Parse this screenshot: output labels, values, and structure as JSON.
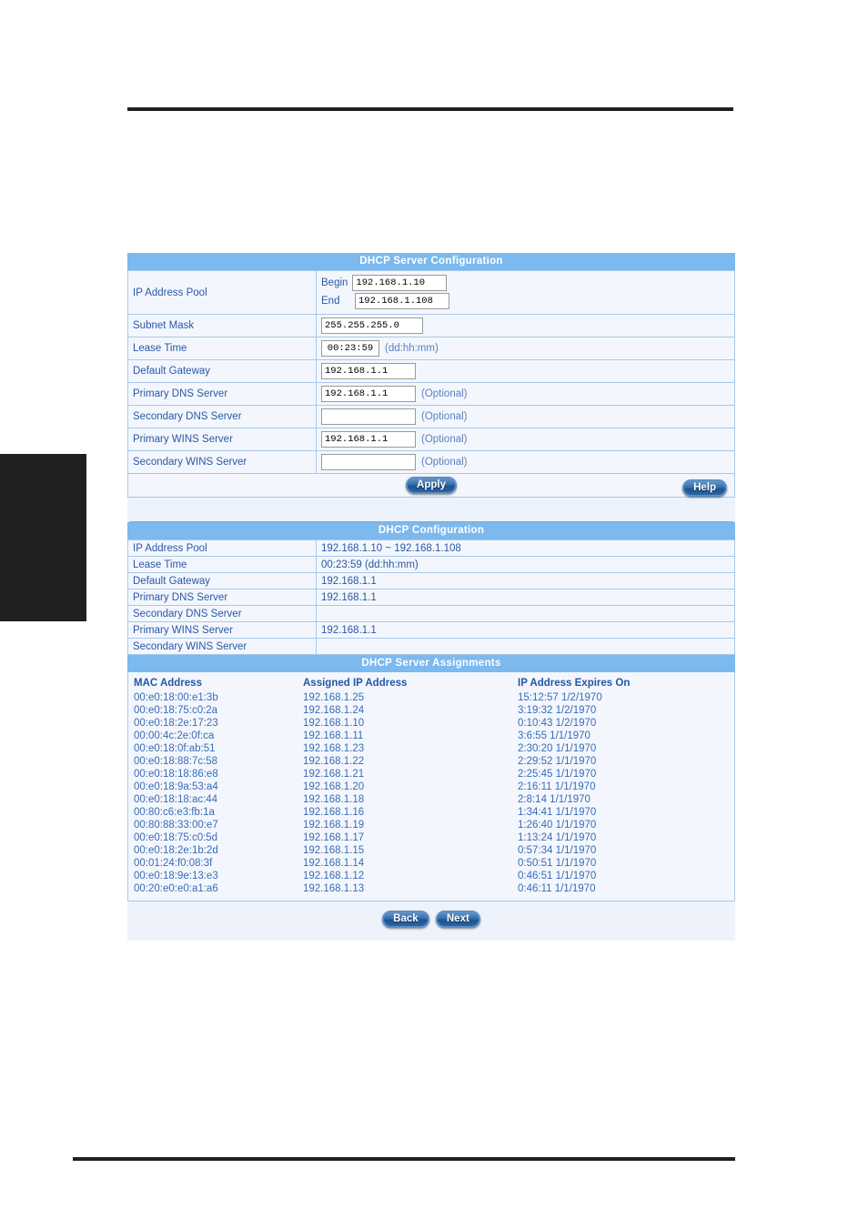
{
  "colors": {
    "bar": "#7bb9ef",
    "panel_bg": "#eef3fb",
    "cell_bg": "#f3f7fd",
    "border": "#a8c8ea",
    "text_blue": "#2b57a6",
    "rule": "#211f1f"
  },
  "config_form": {
    "title": "DHCP Server Configuration",
    "rows": {
      "ip_pool_label": "IP Address Pool",
      "begin_label": "Begin",
      "begin_value": "192.168.1.10",
      "end_label": "End",
      "end_value": "192.168.1.108",
      "subnet_mask_label": "Subnet Mask",
      "subnet_mask_value": "255.255.255.0",
      "lease_time_label": "Lease Time",
      "lease_time_value": "00:23:59",
      "lease_time_format": "(dd:hh:mm)",
      "default_gateway_label": "Default Gateway",
      "default_gateway_value": "192.168.1.1",
      "primary_dns_label": "Primary DNS Server",
      "primary_dns_value": "192.168.1.1",
      "primary_dns_optional": "(Optional)",
      "secondary_dns_label": "Secondary DNS Server",
      "secondary_dns_value": "",
      "secondary_dns_optional": "(Optional)",
      "primary_wins_label": "Primary WINS Server",
      "primary_wins_value": "192.168.1.1",
      "primary_wins_optional": "(Optional)",
      "secondary_wins_label": "Secondary WINS Server",
      "secondary_wins_value": "",
      "secondary_wins_optional": "(Optional)"
    },
    "apply_label": "Apply",
    "help_label": "Help"
  },
  "config_summary": {
    "title": "DHCP Configuration",
    "rows": [
      {
        "key": "IP Address Pool",
        "value": "192.168.1.10 ~ 192.168.1.108"
      },
      {
        "key": "Lease Time",
        "value": "00:23:59 (dd:hh:mm)"
      },
      {
        "key": "Default Gateway",
        "value": "192.168.1.1"
      },
      {
        "key": "Primary DNS Server",
        "value": "192.168.1.1"
      },
      {
        "key": "Secondary DNS Server",
        "value": ""
      },
      {
        "key": "Primary WINS Server",
        "value": "192.168.1.1"
      },
      {
        "key": "Secondary WINS Server",
        "value": ""
      }
    ]
  },
  "assignments": {
    "title": "DHCP Server Assignments",
    "headers": [
      "MAC Address",
      "Assigned IP Address",
      "IP Address Expires On"
    ],
    "rows": [
      {
        "mac": "00:e0:18:00:e1:3b",
        "ip": "192.168.1.25",
        "expires": "15:12:57 1/2/1970"
      },
      {
        "mac": "00:e0:18:75:c0:2a",
        "ip": "192.168.1.24",
        "expires": "3:19:32 1/2/1970"
      },
      {
        "mac": "00:e0:18:2e:17:23",
        "ip": "192.168.1.10",
        "expires": "0:10:43 1/2/1970"
      },
      {
        "mac": "00:00:4c:2e:0f:ca",
        "ip": "192.168.1.11",
        "expires": "3:6:55 1/1/1970"
      },
      {
        "mac": "00:e0:18:0f:ab:51",
        "ip": "192.168.1.23",
        "expires": "2:30:20 1/1/1970"
      },
      {
        "mac": "00:e0:18:88:7c:58",
        "ip": "192.168.1.22",
        "expires": "2:29:52 1/1/1970"
      },
      {
        "mac": "00:e0:18:18:86:e8",
        "ip": "192.168.1.21",
        "expires": "2:25:45 1/1/1970"
      },
      {
        "mac": "00:e0:18:9a:53:a4",
        "ip": "192.168.1.20",
        "expires": "2:16:11 1/1/1970"
      },
      {
        "mac": "00:e0:18:18:ac:44",
        "ip": "192.168.1.18",
        "expires": "2:8:14 1/1/1970"
      },
      {
        "mac": "00:80:c6:e3:fb:1a",
        "ip": "192.168.1.16",
        "expires": "1:34:41 1/1/1970"
      },
      {
        "mac": "00:80:88:33:00:e7",
        "ip": "192.168.1.19",
        "expires": "1:26:40 1/1/1970"
      },
      {
        "mac": "00:e0:18:75:c0:5d",
        "ip": "192.168.1.17",
        "expires": "1:13:24 1/1/1970"
      },
      {
        "mac": "00:e0:18:2e:1b:2d",
        "ip": "192.168.1.15",
        "expires": "0:57:34 1/1/1970"
      },
      {
        "mac": "00:01:24:f0:08:3f",
        "ip": "192.168.1.14",
        "expires": "0:50:51 1/1/1970"
      },
      {
        "mac": "00:e0:18:9e:13:e3",
        "ip": "192.168.1.12",
        "expires": "0:46:51 1/1/1970"
      },
      {
        "mac": "00:20:e0:e0:a1:a6",
        "ip": "192.168.1.13",
        "expires": "0:46:11 1/1/1970"
      }
    ]
  },
  "footer": {
    "back_label": "Back",
    "next_label": "Next"
  }
}
